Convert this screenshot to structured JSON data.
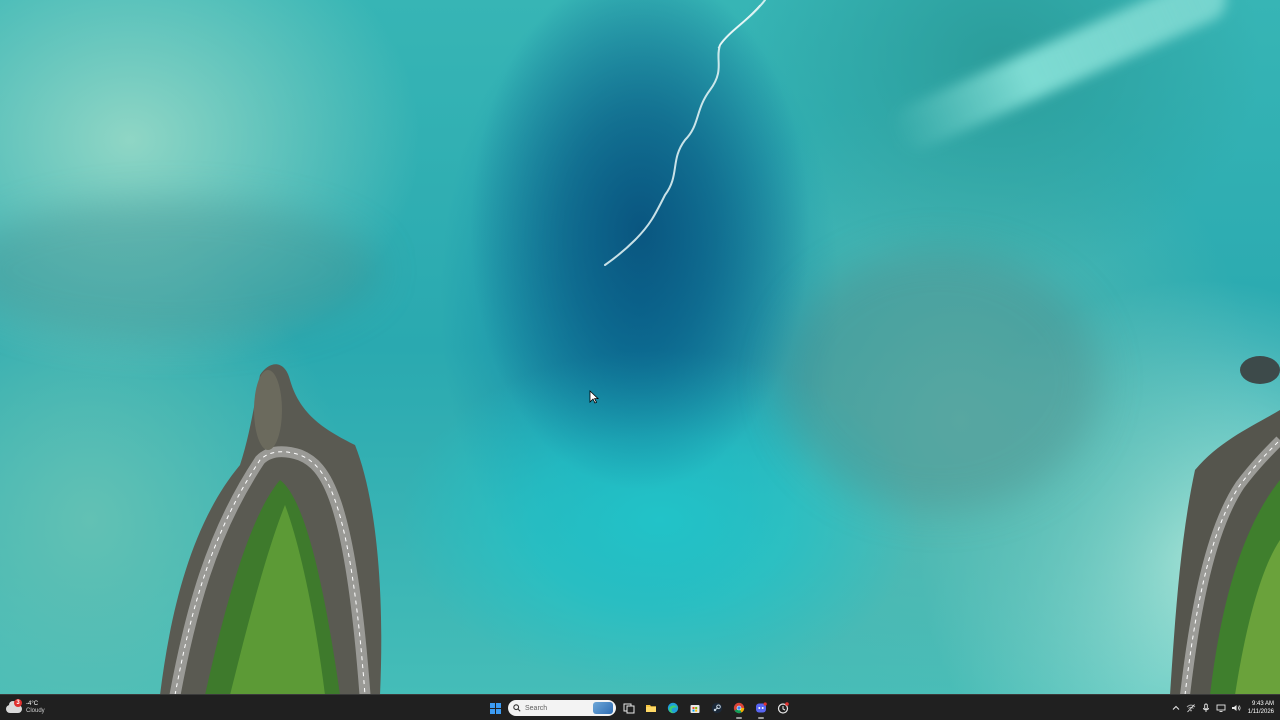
{
  "desktop": {
    "wallpaper": "aerial-lagoon-wallpaper"
  },
  "taskbar": {
    "weather": {
      "temperature": "-4°C",
      "condition": "Cloudy",
      "badge_count": "3",
      "icon": "cloud-icon"
    },
    "search": {
      "placeholder": "Search"
    },
    "pinned_apps": [
      {
        "name": "task-view",
        "icon": "task-view-icon"
      },
      {
        "name": "file-explorer",
        "icon": "folder-icon"
      },
      {
        "name": "edge",
        "icon": "edge-icon"
      },
      {
        "name": "microsoft-store",
        "icon": "store-icon"
      },
      {
        "name": "steam",
        "icon": "steam-icon"
      },
      {
        "name": "chrome",
        "icon": "chrome-icon"
      },
      {
        "name": "discord",
        "icon": "discord-icon"
      },
      {
        "name": "app-with-badge",
        "icon": "red-badge-app-icon"
      }
    ],
    "tray": {
      "icons": [
        "chevron-up-icon",
        "network-off-icon",
        "microphone-icon",
        "monitor-icon",
        "speaker-icon"
      ]
    },
    "clock": {
      "time": "9:43 AM",
      "date": "1/11/2026"
    }
  },
  "colors": {
    "taskbar_bg": "#202020",
    "start_blue": "#3c9bf2",
    "badge_red": "#e0312f"
  }
}
